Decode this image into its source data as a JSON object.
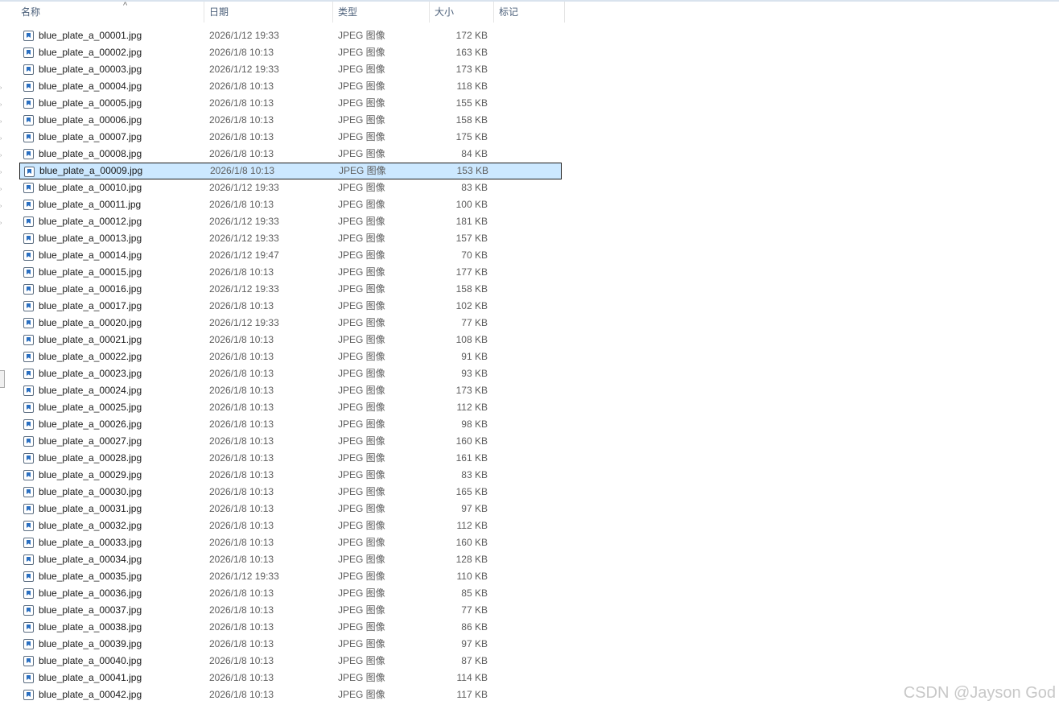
{
  "columns": {
    "name": "名称",
    "date": "日期",
    "type": "类型",
    "size": "大小",
    "tags": "标记"
  },
  "selected_index": 8,
  "watermark": "CSDN @Jayson God",
  "files": [
    [
      "blue_plate_a_00001.jpg",
      "2026/1/12 19:33",
      "JPEG 图像",
      "172 KB"
    ],
    [
      "blue_plate_a_00002.jpg",
      "2026/1/8 10:13",
      "JPEG 图像",
      "163 KB"
    ],
    [
      "blue_plate_a_00003.jpg",
      "2026/1/12 19:33",
      "JPEG 图像",
      "173 KB"
    ],
    [
      "blue_plate_a_00004.jpg",
      "2026/1/8 10:13",
      "JPEG 图像",
      "118 KB"
    ],
    [
      "blue_plate_a_00005.jpg",
      "2026/1/8 10:13",
      "JPEG 图像",
      "155 KB"
    ],
    [
      "blue_plate_a_00006.jpg",
      "2026/1/8 10:13",
      "JPEG 图像",
      "158 KB"
    ],
    [
      "blue_plate_a_00007.jpg",
      "2026/1/8 10:13",
      "JPEG 图像",
      "175 KB"
    ],
    [
      "blue_plate_a_00008.jpg",
      "2026/1/8 10:13",
      "JPEG 图像",
      "84 KB"
    ],
    [
      "blue_plate_a_00009.jpg",
      "2026/1/8 10:13",
      "JPEG 图像",
      "153 KB"
    ],
    [
      "blue_plate_a_00010.jpg",
      "2026/1/12 19:33",
      "JPEG 图像",
      "83 KB"
    ],
    [
      "blue_plate_a_00011.jpg",
      "2026/1/8 10:13",
      "JPEG 图像",
      "100 KB"
    ],
    [
      "blue_plate_a_00012.jpg",
      "2026/1/12 19:33",
      "JPEG 图像",
      "181 KB"
    ],
    [
      "blue_plate_a_00013.jpg",
      "2026/1/12 19:33",
      "JPEG 图像",
      "157 KB"
    ],
    [
      "blue_plate_a_00014.jpg",
      "2026/1/12 19:47",
      "JPEG 图像",
      "70 KB"
    ],
    [
      "blue_plate_a_00015.jpg",
      "2026/1/8 10:13",
      "JPEG 图像",
      "177 KB"
    ],
    [
      "blue_plate_a_00016.jpg",
      "2026/1/12 19:33",
      "JPEG 图像",
      "158 KB"
    ],
    [
      "blue_plate_a_00017.jpg",
      "2026/1/8 10:13",
      "JPEG 图像",
      "102 KB"
    ],
    [
      "blue_plate_a_00020.jpg",
      "2026/1/12 19:33",
      "JPEG 图像",
      "77 KB"
    ],
    [
      "blue_plate_a_00021.jpg",
      "2026/1/8 10:13",
      "JPEG 图像",
      "108 KB"
    ],
    [
      "blue_plate_a_00022.jpg",
      "2026/1/8 10:13",
      "JPEG 图像",
      "91 KB"
    ],
    [
      "blue_plate_a_00023.jpg",
      "2026/1/8 10:13",
      "JPEG 图像",
      "93 KB"
    ],
    [
      "blue_plate_a_00024.jpg",
      "2026/1/8 10:13",
      "JPEG 图像",
      "173 KB"
    ],
    [
      "blue_plate_a_00025.jpg",
      "2026/1/8 10:13",
      "JPEG 图像",
      "112 KB"
    ],
    [
      "blue_plate_a_00026.jpg",
      "2026/1/8 10:13",
      "JPEG 图像",
      "98 KB"
    ],
    [
      "blue_plate_a_00027.jpg",
      "2026/1/8 10:13",
      "JPEG 图像",
      "160 KB"
    ],
    [
      "blue_plate_a_00028.jpg",
      "2026/1/8 10:13",
      "JPEG 图像",
      "161 KB"
    ],
    [
      "blue_plate_a_00029.jpg",
      "2026/1/8 10:13",
      "JPEG 图像",
      "83 KB"
    ],
    [
      "blue_plate_a_00030.jpg",
      "2026/1/8 10:13",
      "JPEG 图像",
      "165 KB"
    ],
    [
      "blue_plate_a_00031.jpg",
      "2026/1/8 10:13",
      "JPEG 图像",
      "97 KB"
    ],
    [
      "blue_plate_a_00032.jpg",
      "2026/1/8 10:13",
      "JPEG 图像",
      "112 KB"
    ],
    [
      "blue_plate_a_00033.jpg",
      "2026/1/8 10:13",
      "JPEG 图像",
      "160 KB"
    ],
    [
      "blue_plate_a_00034.jpg",
      "2026/1/8 10:13",
      "JPEG 图像",
      "128 KB"
    ],
    [
      "blue_plate_a_00035.jpg",
      "2026/1/12 19:33",
      "JPEG 图像",
      "110 KB"
    ],
    [
      "blue_plate_a_00036.jpg",
      "2026/1/8 10:13",
      "JPEG 图像",
      "85 KB"
    ],
    [
      "blue_plate_a_00037.jpg",
      "2026/1/8 10:13",
      "JPEG 图像",
      "77 KB"
    ],
    [
      "blue_plate_a_00038.jpg",
      "2026/1/8 10:13",
      "JPEG 图像",
      "86 KB"
    ],
    [
      "blue_plate_a_00039.jpg",
      "2026/1/8 10:13",
      "JPEG 图像",
      "97 KB"
    ],
    [
      "blue_plate_a_00040.jpg",
      "2026/1/8 10:13",
      "JPEG 图像",
      "87 KB"
    ],
    [
      "blue_plate_a_00041.jpg",
      "2026/1/8 10:13",
      "JPEG 图像",
      "114 KB"
    ],
    [
      "blue_plate_a_00042.jpg",
      "2026/1/8 10:13",
      "JPEG 图像",
      "117 KB"
    ]
  ]
}
